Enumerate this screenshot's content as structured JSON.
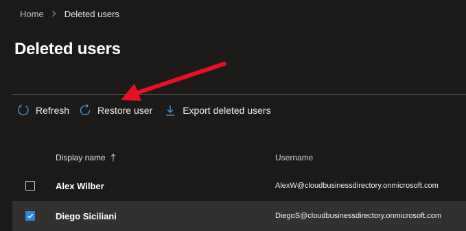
{
  "breadcrumb": {
    "home": "Home",
    "current": "Deleted users"
  },
  "page": {
    "title": "Deleted users"
  },
  "toolbar": {
    "refresh_label": "Refresh",
    "restore_label": "Restore user",
    "export_label": "Export deleted users"
  },
  "table": {
    "columns": {
      "display_name": "Display name",
      "username": "Username"
    },
    "rows": [
      {
        "display_name": "Alex Wilber",
        "username": "AlexW@cloudbusinessdirectory.onmicrosoft.com",
        "selected": false
      },
      {
        "display_name": "Diego Siciliani",
        "username": "DiegoS@cloudbusinessdirectory.onmicrosoft.com",
        "selected": true
      }
    ]
  },
  "colors": {
    "background": "#1b1a19",
    "accent": "#2b88d8",
    "selected_row": "#323130",
    "annotation_arrow": "#e81123"
  }
}
